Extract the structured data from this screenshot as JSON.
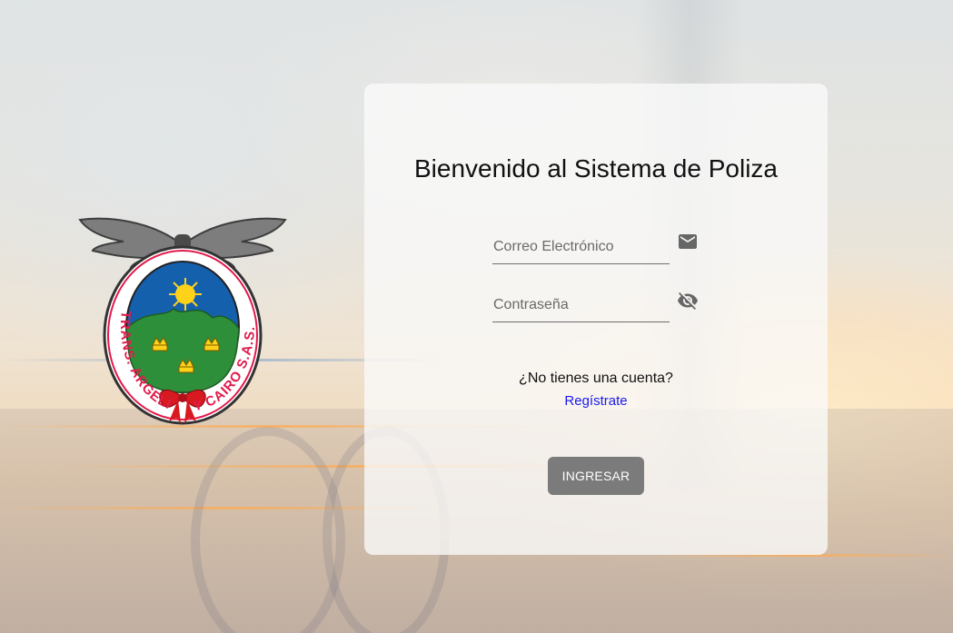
{
  "login": {
    "title": "Bienvenido al Sistema de Poliza",
    "email": {
      "placeholder": "Correo Electrónico",
      "icon": "mail-icon"
    },
    "password": {
      "placeholder": "Contraseña",
      "icon": "eye-off-icon"
    },
    "no_account_text": "¿No tienes una cuenta?",
    "register_link": "Regístrate",
    "submit_label": "INGRESAR"
  },
  "logo": {
    "arc_text_left": "TRANS. ARGELIA",
    "arc_text_right": "Y CAIRO S.A.S.",
    "icon": "company-logo-emblem"
  },
  "colors": {
    "button": "#7b7b7b",
    "link": "#1a1aee",
    "card": "#fafafa",
    "logo_red": "#e21a4b",
    "logo_blue": "#1560ad",
    "logo_green": "#2e8f3a"
  }
}
